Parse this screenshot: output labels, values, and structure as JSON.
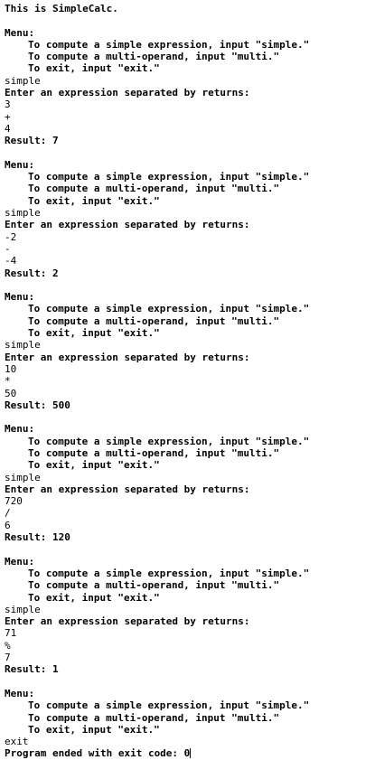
{
  "console": {
    "lines": [
      {
        "text": "This is SimpleCalc.",
        "style": "bold"
      },
      {
        "text": "",
        "style": "blank"
      },
      {
        "text": "Menu:",
        "style": "bold"
      },
      {
        "text": "To compute a simple expression, input \"simple.\"",
        "style": "bold-indent"
      },
      {
        "text": "To compute a multi-operand, input \"multi.\"",
        "style": "bold-indent"
      },
      {
        "text": "To exit, input \"exit.\"",
        "style": "bold-indent"
      },
      {
        "text": "simple",
        "style": "input"
      },
      {
        "text": "Enter an expression separated by returns:",
        "style": "bold"
      },
      {
        "text": "3",
        "style": "input"
      },
      {
        "text": "+",
        "style": "input"
      },
      {
        "text": "4",
        "style": "input"
      },
      {
        "text": "Result: 7",
        "style": "bold"
      },
      {
        "text": "",
        "style": "blank"
      },
      {
        "text": "Menu:",
        "style": "bold"
      },
      {
        "text": "To compute a simple expression, input \"simple.\"",
        "style": "bold-indent"
      },
      {
        "text": "To compute a multi-operand, input \"multi.\"",
        "style": "bold-indent"
      },
      {
        "text": "To exit, input \"exit.\"",
        "style": "bold-indent"
      },
      {
        "text": "simple",
        "style": "input"
      },
      {
        "text": "Enter an expression separated by returns:",
        "style": "bold"
      },
      {
        "text": "-2",
        "style": "input"
      },
      {
        "text": "-",
        "style": "input"
      },
      {
        "text": "-4",
        "style": "input"
      },
      {
        "text": "Result: 2",
        "style": "bold"
      },
      {
        "text": "",
        "style": "blank"
      },
      {
        "text": "Menu:",
        "style": "bold"
      },
      {
        "text": "To compute a simple expression, input \"simple.\"",
        "style": "bold-indent"
      },
      {
        "text": "To compute a multi-operand, input \"multi.\"",
        "style": "bold-indent"
      },
      {
        "text": "To exit, input \"exit.\"",
        "style": "bold-indent"
      },
      {
        "text": "simple",
        "style": "input"
      },
      {
        "text": "Enter an expression separated by returns:",
        "style": "bold"
      },
      {
        "text": "10",
        "style": "input"
      },
      {
        "text": "*",
        "style": "input"
      },
      {
        "text": "50",
        "style": "input"
      },
      {
        "text": "Result: 500",
        "style": "bold"
      },
      {
        "text": "",
        "style": "blank"
      },
      {
        "text": "Menu:",
        "style": "bold"
      },
      {
        "text": "To compute a simple expression, input \"simple.\"",
        "style": "bold-indent"
      },
      {
        "text": "To compute a multi-operand, input \"multi.\"",
        "style": "bold-indent"
      },
      {
        "text": "To exit, input \"exit.\"",
        "style": "bold-indent"
      },
      {
        "text": "simple",
        "style": "input"
      },
      {
        "text": "Enter an expression separated by returns:",
        "style": "bold"
      },
      {
        "text": "720",
        "style": "input"
      },
      {
        "text": "/",
        "style": "input"
      },
      {
        "text": "6",
        "style": "input"
      },
      {
        "text": "Result: 120",
        "style": "bold"
      },
      {
        "text": "",
        "style": "blank"
      },
      {
        "text": "Menu:",
        "style": "bold"
      },
      {
        "text": "To compute a simple expression, input \"simple.\"",
        "style": "bold-indent"
      },
      {
        "text": "To compute a multi-operand, input \"multi.\"",
        "style": "bold-indent"
      },
      {
        "text": "To exit, input \"exit.\"",
        "style": "bold-indent"
      },
      {
        "text": "simple",
        "style": "input"
      },
      {
        "text": "Enter an expression separated by returns:",
        "style": "bold"
      },
      {
        "text": "71",
        "style": "input"
      },
      {
        "text": "%",
        "style": "input"
      },
      {
        "text": "7",
        "style": "input"
      },
      {
        "text": "Result: 1",
        "style": "bold"
      },
      {
        "text": "",
        "style": "blank"
      },
      {
        "text": "Menu:",
        "style": "bold"
      },
      {
        "text": "To compute a simple expression, input \"simple.\"",
        "style": "bold-indent"
      },
      {
        "text": "To compute a multi-operand, input \"multi.\"",
        "style": "bold-indent"
      },
      {
        "text": "To exit, input \"exit.\"",
        "style": "bold-indent"
      },
      {
        "text": "exit",
        "style": "input"
      }
    ],
    "final_line": "Program ended with exit code: 0"
  }
}
